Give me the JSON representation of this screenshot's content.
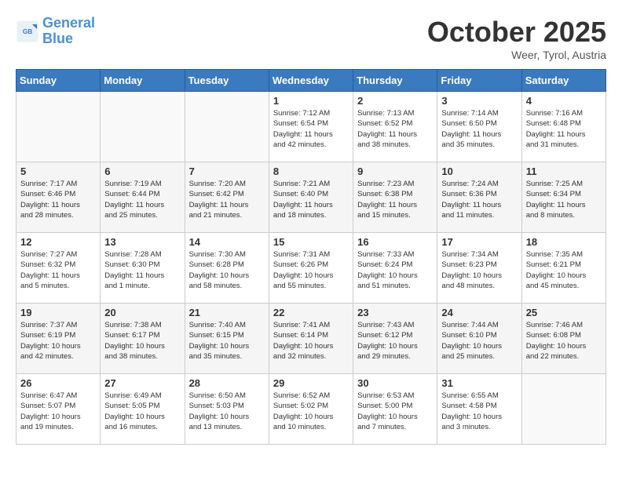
{
  "header": {
    "logo_line1": "General",
    "logo_line2": "Blue",
    "month": "October 2025",
    "location": "Weer, Tyrol, Austria"
  },
  "days_of_week": [
    "Sunday",
    "Monday",
    "Tuesday",
    "Wednesday",
    "Thursday",
    "Friday",
    "Saturday"
  ],
  "weeks": [
    [
      {
        "day": "",
        "info": ""
      },
      {
        "day": "",
        "info": ""
      },
      {
        "day": "",
        "info": ""
      },
      {
        "day": "1",
        "info": "Sunrise: 7:12 AM\nSunset: 6:54 PM\nDaylight: 11 hours\nand 42 minutes."
      },
      {
        "day": "2",
        "info": "Sunrise: 7:13 AM\nSunset: 6:52 PM\nDaylight: 11 hours\nand 38 minutes."
      },
      {
        "day": "3",
        "info": "Sunrise: 7:14 AM\nSunset: 6:50 PM\nDaylight: 11 hours\nand 35 minutes."
      },
      {
        "day": "4",
        "info": "Sunrise: 7:16 AM\nSunset: 6:48 PM\nDaylight: 11 hours\nand 31 minutes."
      }
    ],
    [
      {
        "day": "5",
        "info": "Sunrise: 7:17 AM\nSunset: 6:46 PM\nDaylight: 11 hours\nand 28 minutes."
      },
      {
        "day": "6",
        "info": "Sunrise: 7:19 AM\nSunset: 6:44 PM\nDaylight: 11 hours\nand 25 minutes."
      },
      {
        "day": "7",
        "info": "Sunrise: 7:20 AM\nSunset: 6:42 PM\nDaylight: 11 hours\nand 21 minutes."
      },
      {
        "day": "8",
        "info": "Sunrise: 7:21 AM\nSunset: 6:40 PM\nDaylight: 11 hours\nand 18 minutes."
      },
      {
        "day": "9",
        "info": "Sunrise: 7:23 AM\nSunset: 6:38 PM\nDaylight: 11 hours\nand 15 minutes."
      },
      {
        "day": "10",
        "info": "Sunrise: 7:24 AM\nSunset: 6:36 PM\nDaylight: 11 hours\nand 11 minutes."
      },
      {
        "day": "11",
        "info": "Sunrise: 7:25 AM\nSunset: 6:34 PM\nDaylight: 11 hours\nand 8 minutes."
      }
    ],
    [
      {
        "day": "12",
        "info": "Sunrise: 7:27 AM\nSunset: 6:32 PM\nDaylight: 11 hours\nand 5 minutes."
      },
      {
        "day": "13",
        "info": "Sunrise: 7:28 AM\nSunset: 6:30 PM\nDaylight: 11 hours\nand 1 minute."
      },
      {
        "day": "14",
        "info": "Sunrise: 7:30 AM\nSunset: 6:28 PM\nDaylight: 10 hours\nand 58 minutes."
      },
      {
        "day": "15",
        "info": "Sunrise: 7:31 AM\nSunset: 6:26 PM\nDaylight: 10 hours\nand 55 minutes."
      },
      {
        "day": "16",
        "info": "Sunrise: 7:33 AM\nSunset: 6:24 PM\nDaylight: 10 hours\nand 51 minutes."
      },
      {
        "day": "17",
        "info": "Sunrise: 7:34 AM\nSunset: 6:23 PM\nDaylight: 10 hours\nand 48 minutes."
      },
      {
        "day": "18",
        "info": "Sunrise: 7:35 AM\nSunset: 6:21 PM\nDaylight: 10 hours\nand 45 minutes."
      }
    ],
    [
      {
        "day": "19",
        "info": "Sunrise: 7:37 AM\nSunset: 6:19 PM\nDaylight: 10 hours\nand 42 minutes."
      },
      {
        "day": "20",
        "info": "Sunrise: 7:38 AM\nSunset: 6:17 PM\nDaylight: 10 hours\nand 38 minutes."
      },
      {
        "day": "21",
        "info": "Sunrise: 7:40 AM\nSunset: 6:15 PM\nDaylight: 10 hours\nand 35 minutes."
      },
      {
        "day": "22",
        "info": "Sunrise: 7:41 AM\nSunset: 6:14 PM\nDaylight: 10 hours\nand 32 minutes."
      },
      {
        "day": "23",
        "info": "Sunrise: 7:43 AM\nSunset: 6:12 PM\nDaylight: 10 hours\nand 29 minutes."
      },
      {
        "day": "24",
        "info": "Sunrise: 7:44 AM\nSunset: 6:10 PM\nDaylight: 10 hours\nand 25 minutes."
      },
      {
        "day": "25",
        "info": "Sunrise: 7:46 AM\nSunset: 6:08 PM\nDaylight: 10 hours\nand 22 minutes."
      }
    ],
    [
      {
        "day": "26",
        "info": "Sunrise: 6:47 AM\nSunset: 5:07 PM\nDaylight: 10 hours\nand 19 minutes."
      },
      {
        "day": "27",
        "info": "Sunrise: 6:49 AM\nSunset: 5:05 PM\nDaylight: 10 hours\nand 16 minutes."
      },
      {
        "day": "28",
        "info": "Sunrise: 6:50 AM\nSunset: 5:03 PM\nDaylight: 10 hours\nand 13 minutes."
      },
      {
        "day": "29",
        "info": "Sunrise: 6:52 AM\nSunset: 5:02 PM\nDaylight: 10 hours\nand 10 minutes."
      },
      {
        "day": "30",
        "info": "Sunrise: 6:53 AM\nSunset: 5:00 PM\nDaylight: 10 hours\nand 7 minutes."
      },
      {
        "day": "31",
        "info": "Sunrise: 6:55 AM\nSunset: 4:58 PM\nDaylight: 10 hours\nand 3 minutes."
      },
      {
        "day": "",
        "info": ""
      }
    ]
  ]
}
